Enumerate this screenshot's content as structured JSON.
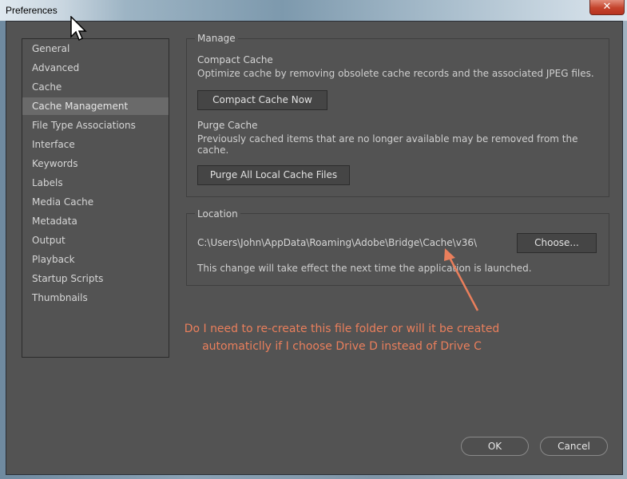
{
  "window": {
    "title": "Preferences",
    "close_glyph": "✕"
  },
  "sidebar": {
    "items": [
      {
        "label": "General"
      },
      {
        "label": "Advanced"
      },
      {
        "label": "Cache"
      },
      {
        "label": "Cache Management"
      },
      {
        "label": "File Type Associations"
      },
      {
        "label": "Interface"
      },
      {
        "label": "Keywords"
      },
      {
        "label": "Labels"
      },
      {
        "label": "Media Cache"
      },
      {
        "label": "Metadata"
      },
      {
        "label": "Output"
      },
      {
        "label": "Playback"
      },
      {
        "label": "Startup Scripts"
      },
      {
        "label": "Thumbnails"
      }
    ],
    "selected": "Cache Management"
  },
  "manage": {
    "group_label": "Manage",
    "compact_title": "Compact Cache",
    "compact_desc": "Optimize cache by removing obsolete cache records and the associated JPEG files.",
    "compact_button": "Compact Cache Now",
    "purge_title": "Purge Cache",
    "purge_desc_line1": "Previously cached items that are no longer available may be removed from the",
    "purge_desc_line2": "cache.",
    "purge_button": "Purge All Local Cache Files"
  },
  "location": {
    "group_label": "Location",
    "path": "C:\\Users\\John\\AppData\\Roaming\\Adobe\\Bridge\\Cache\\v36\\",
    "choose_button": "Choose...",
    "note": "This change will take effect the next time the application is launched."
  },
  "annotation": {
    "line1": "Do I need to re-create this file folder or will it be created",
    "line2": "automaticlly if I choose Drive D instead of Drive C",
    "color": "#ea7f5c"
  },
  "footer": {
    "ok_button": "OK",
    "cancel_button": "Cancel"
  },
  "colors": {
    "panel": "#535353",
    "selected_item": "#6a6a6a",
    "text": "#d6d6d6"
  }
}
